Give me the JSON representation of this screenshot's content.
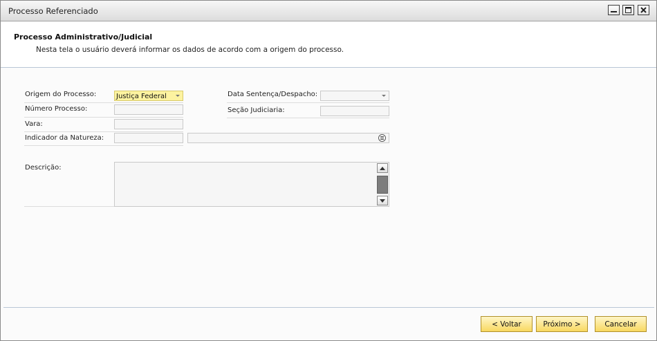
{
  "window": {
    "title": "Processo Referenciado"
  },
  "header": {
    "title": "Processo Administrativo/Judicial",
    "subtitle": "Nesta tela o usuário deverá informar os dados de acordo com a origem do processo."
  },
  "form": {
    "origem_label": "Origem do Processo:",
    "origem_value": "Justiça Federal",
    "numero_label": "Número Processo:",
    "numero_value": "",
    "vara_label": "Vara:",
    "vara_value": "",
    "indicador_label": "Indicador da Natureza:",
    "indicador_code": "",
    "indicador_desc": "",
    "data_label": "Data Sentença/Despacho:",
    "data_value": "",
    "secao_label": "Seção Judiciaria:",
    "secao_value": "",
    "descricao_label": "Descrição:",
    "descricao_value": ""
  },
  "buttons": {
    "back": "< Voltar",
    "next": "Próximo >",
    "cancel": "Cancelar"
  },
  "colors": {
    "highlight_field": "#fdf3a0",
    "button_fill": "#f8d860",
    "separator": "#b9c6d6"
  }
}
